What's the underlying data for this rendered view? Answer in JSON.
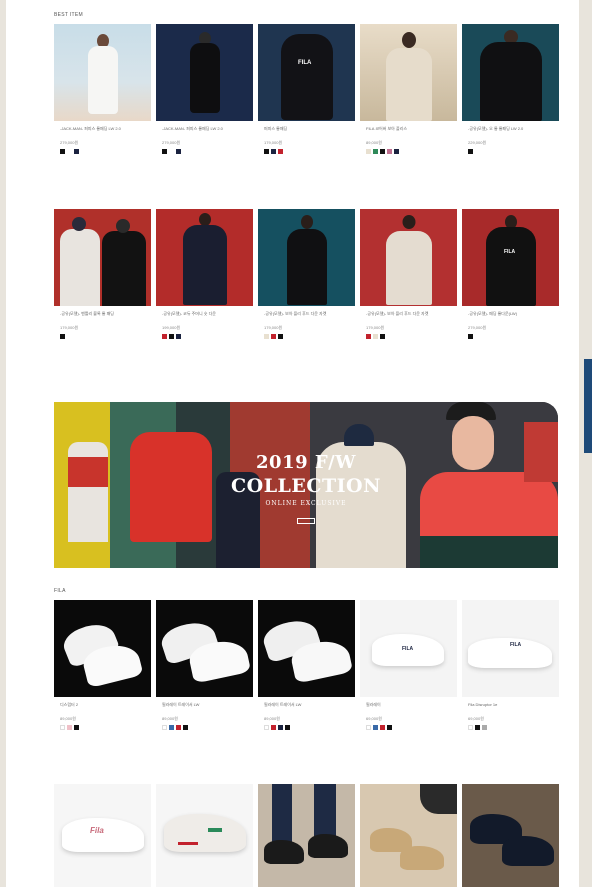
{
  "best_section": {
    "label": "BEST ITEM"
  },
  "row1": [
    {
      "name": "-JACK-MAN- 퍼피스 롱패딩 LW 2.0",
      "price": "279,000원",
      "swatches": [
        "#111111",
        "#ffffff",
        "#1b2340"
      ]
    },
    {
      "name": "-JACK-MAN- 퍼피스 롱패딩 LW 2.0",
      "price": "279,000원",
      "swatches": [
        "#111111",
        "#ffffff",
        "#1b2340"
      ]
    },
    {
      "name": "퍼피스 롱패딩",
      "price": "179,000원",
      "swatches": [
        "#111111",
        "#1b2340",
        "#c2222d"
      ]
    },
    {
      "name": "FILA 코어버 보아 플리스",
      "price": "89,000원",
      "swatches": [
        "#e8e0d0",
        "#2f8a5a",
        "#111111",
        "#c07090",
        "#1b2340"
      ]
    },
    {
      "name": "-공유(모델)- 오 롱 롱패딩 LW 2.0",
      "price": "229,000원",
      "swatches": [
        "#111111"
      ]
    }
  ],
  "row2": [
    {
      "name": "-공유(모델)- 벤틀리 블록 롱 패딩",
      "price": "179,000원",
      "swatches": [
        "#111111"
      ]
    },
    {
      "name": "-공유(모델)- 코듀 주머니 숏 다운",
      "price": "199,000원",
      "swatches": [
        "#c2222d",
        "#111111",
        "#1b2340"
      ]
    },
    {
      "name": "-공유(모델)- 보아 플리 후드 다운 자켓",
      "price": "179,000원",
      "swatches": [
        "#e8e0d0",
        "#c2222d",
        "#111111"
      ]
    },
    {
      "name": "-공유(모델)- 보아 플리 후드 다운 자켓",
      "price": "179,000원",
      "swatches": [
        "#c2222d",
        "#e8e0d0",
        "#111111"
      ]
    },
    {
      "name": "-공유(모델)- 패딩 롱다운(LW)",
      "price": "279,000원",
      "swatches": [
        "#111111"
      ]
    }
  ],
  "banner": {
    "title_line1": "2019 F/W",
    "title_line2": "COLLECTION",
    "subtitle": "ONLINE EXCLUSIVE"
  },
  "shoe_section": {
    "label": "FILA"
  },
  "row3": [
    {
      "name": "디스럽터 2",
      "price": "89,000원",
      "swatches": [
        "#ffffff",
        "#f0c0c8",
        "#111111"
      ]
    },
    {
      "name": "필라레이 트레이서 LW",
      "price": "89,000원",
      "swatches": [
        "#ffffff",
        "#3a6aa8",
        "#c2222d",
        "#111111"
      ]
    },
    {
      "name": "필라레이 트레이서 LW",
      "price": "89,000원",
      "swatches": [
        "#ffffff",
        "#c2222d",
        "#1b2340",
        "#111111"
      ]
    },
    {
      "name": "필라레이",
      "price": "69,000원",
      "swatches": [
        "#ffffff",
        "#3a6aa8",
        "#c2222d",
        "#111111"
      ]
    },
    {
      "name": "Fila Disruptor 1e",
      "price": "69,000원",
      "swatches": [
        "#ffffff",
        "#111111",
        "#aaaaaa"
      ]
    }
  ],
  "colors": {
    "accent": "#1e4a78",
    "page_bg": "#e8e4dc"
  }
}
